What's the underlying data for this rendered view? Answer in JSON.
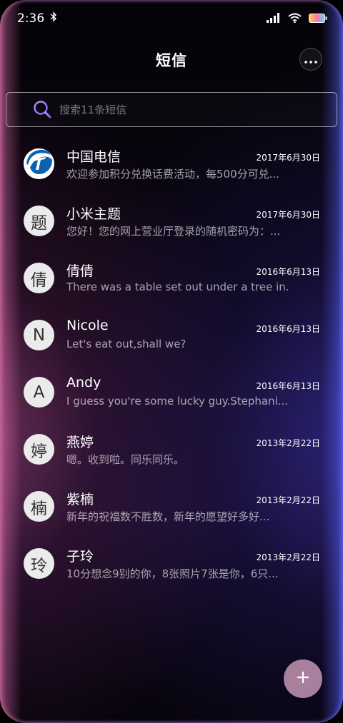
{
  "status_bar": {
    "time": "2:36",
    "icons": [
      "bluetooth-icon",
      "signal-icon",
      "wifi-icon",
      "battery-icon"
    ]
  },
  "header": {
    "title": "短信",
    "more_icon": "more-dots-icon"
  },
  "search": {
    "placeholder": "搜索11条短信",
    "icon": "search-icon"
  },
  "conversations": [
    {
      "name": "中国电信",
      "date": "2017年6月30日",
      "preview": "欢迎参加积分兑换话费活动，每500分可兑...",
      "avatar": "",
      "avatar_type": "logo"
    },
    {
      "name": "小米主题",
      "date": "2017年6月30日",
      "preview": "您好！您的网上营业厅登录的随机密码为：...",
      "avatar": "题"
    },
    {
      "name": "倩倩",
      "date": "2016年6月13日",
      "preview": "There was a table set out under a tree in...",
      "avatar": "倩"
    },
    {
      "name": "Nicole",
      "date": "2016年6月13日",
      "preview": "Let's eat out,shall we?",
      "avatar": "N"
    },
    {
      "name": "Andy",
      "date": "2016年6月13日",
      "preview": "I guess you're some lucky guy.Stephani...",
      "avatar": "A"
    },
    {
      "name": "燕婷",
      "date": "2013年2月22日",
      "preview": "嗯。收到啦。同乐同乐。",
      "avatar": "婷"
    },
    {
      "name": "紫楠",
      "date": "2013年2月22日",
      "preview": "新年的祝福数不胜数，新年的愿望好多好...",
      "avatar": "楠"
    },
    {
      "name": "子玲",
      "date": "2013年2月22日",
      "preview": "10分想念9别的你，8张照片7张是你，6只...",
      "avatar": "玲"
    }
  ],
  "fab": {
    "icon": "plus-icon"
  },
  "colors": {
    "fab": "#a97f9e",
    "avatar_bg": "#ebebeb",
    "telecom_blue": "#0a62b0"
  }
}
